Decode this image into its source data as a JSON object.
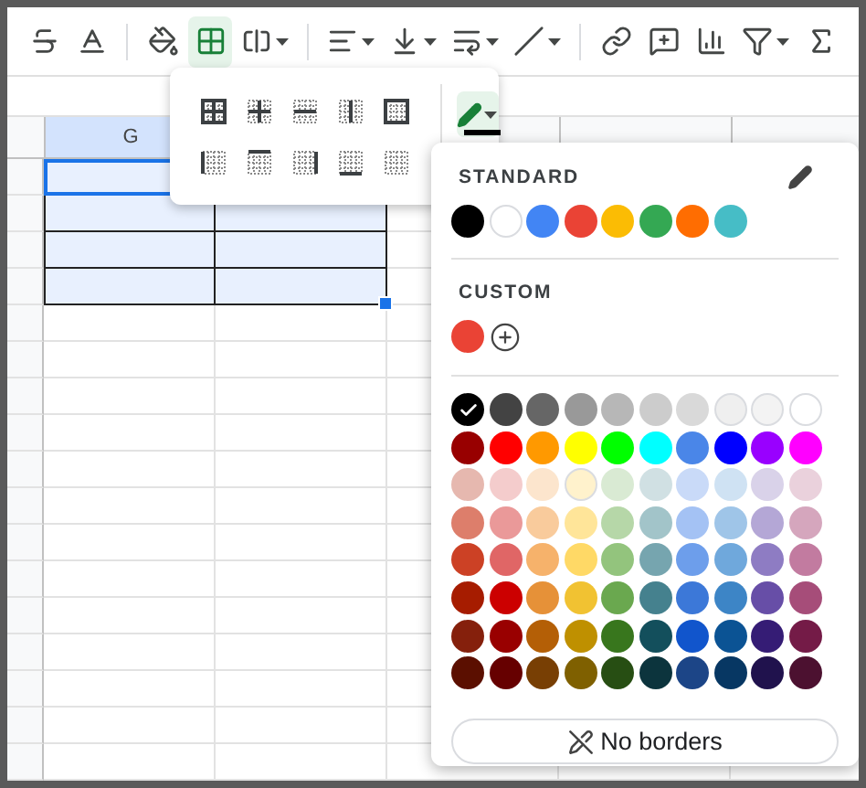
{
  "toolbar": {
    "borders_button": {
      "selected": true
    }
  },
  "column_headers": [
    {
      "label": "G",
      "selected": true
    }
  ],
  "selected_cells": [
    {
      "cells": [
        {
          "selected": true,
          "active": true
        }
      ]
    },
    {
      "cells": [
        {
          "selected": true,
          "active": false
        },
        {
          "selected": true,
          "active": false
        }
      ]
    },
    {
      "cells": [
        {
          "selected": true,
          "active": false
        },
        {
          "selected": true,
          "active": false
        }
      ]
    },
    {
      "cells": [
        {
          "selected": true,
          "active": false
        },
        {
          "selected": true,
          "active": false
        }
      ]
    }
  ],
  "borders_menu": {
    "pen": {
      "color": "#000000"
    }
  },
  "color_panel": {
    "standard_label": "STANDARD",
    "standard": [
      {
        "color": "#000000"
      },
      {
        "color": "#ffffff"
      },
      {
        "color": "#4285f4"
      },
      {
        "color": "#ea4335"
      },
      {
        "color": "#fbbc04"
      },
      {
        "color": "#34a853"
      },
      {
        "color": "#ff6d01"
      },
      {
        "color": "#46bdc6"
      }
    ],
    "custom_label": "CUSTOM",
    "custom": [
      {
        "color": "#ea4335"
      }
    ],
    "palette": [
      [
        {
          "color": "#000000",
          "selected": true
        },
        {
          "color": "#434343",
          "selected": false
        },
        {
          "color": "#666666",
          "selected": false
        },
        {
          "color": "#999999",
          "selected": false
        },
        {
          "color": "#b7b7b7",
          "selected": false
        },
        {
          "color": "#cccccc",
          "selected": false
        },
        {
          "color": "#d9d9d9",
          "selected": false
        },
        {
          "color": "#efefef",
          "selected": false
        },
        {
          "color": "#f3f3f3",
          "selected": false
        },
        {
          "color": "#ffffff",
          "selected": false
        }
      ],
      [
        {
          "color": "#980000",
          "selected": false
        },
        {
          "color": "#ff0000",
          "selected": false
        },
        {
          "color": "#ff9900",
          "selected": false
        },
        {
          "color": "#ffff00",
          "selected": false
        },
        {
          "color": "#00ff00",
          "selected": false
        },
        {
          "color": "#00ffff",
          "selected": false
        },
        {
          "color": "#4a86e8",
          "selected": false
        },
        {
          "color": "#0000ff",
          "selected": false
        },
        {
          "color": "#9900ff",
          "selected": false
        },
        {
          "color": "#ff00ff",
          "selected": false
        }
      ],
      [
        {
          "color": "#e6b8af",
          "selected": false
        },
        {
          "color": "#f4cccc",
          "selected": false
        },
        {
          "color": "#fce5cd",
          "selected": false
        },
        {
          "color": "#fff2cc",
          "selected": false
        },
        {
          "color": "#d9ead3",
          "selected": false
        },
        {
          "color": "#d0e0e3",
          "selected": false
        },
        {
          "color": "#c9daf8",
          "selected": false
        },
        {
          "color": "#cfe2f3",
          "selected": false
        },
        {
          "color": "#d9d2e9",
          "selected": false
        },
        {
          "color": "#ead1dc",
          "selected": false
        }
      ],
      [
        {
          "color": "#dd7e6b",
          "selected": false
        },
        {
          "color": "#ea9999",
          "selected": false
        },
        {
          "color": "#f9cb9c",
          "selected": false
        },
        {
          "color": "#ffe599",
          "selected": false
        },
        {
          "color": "#b6d7a8",
          "selected": false
        },
        {
          "color": "#a2c4c9",
          "selected": false
        },
        {
          "color": "#a4c2f4",
          "selected": false
        },
        {
          "color": "#9fc5e8",
          "selected": false
        },
        {
          "color": "#b4a7d6",
          "selected": false
        },
        {
          "color": "#d5a6bd",
          "selected": false
        }
      ],
      [
        {
          "color": "#cc4125",
          "selected": false
        },
        {
          "color": "#e06666",
          "selected": false
        },
        {
          "color": "#f6b26b",
          "selected": false
        },
        {
          "color": "#ffd966",
          "selected": false
        },
        {
          "color": "#93c47d",
          "selected": false
        },
        {
          "color": "#76a5af",
          "selected": false
        },
        {
          "color": "#6d9eeb",
          "selected": false
        },
        {
          "color": "#6fa8dc",
          "selected": false
        },
        {
          "color": "#8e7cc3",
          "selected": false
        },
        {
          "color": "#c27ba0",
          "selected": false
        }
      ],
      [
        {
          "color": "#a61c00",
          "selected": false
        },
        {
          "color": "#cc0000",
          "selected": false
        },
        {
          "color": "#e69138",
          "selected": false
        },
        {
          "color": "#f1c232",
          "selected": false
        },
        {
          "color": "#6aa84f",
          "selected": false
        },
        {
          "color": "#45818e",
          "selected": false
        },
        {
          "color": "#3c78d8",
          "selected": false
        },
        {
          "color": "#3d85c6",
          "selected": false
        },
        {
          "color": "#674ea7",
          "selected": false
        },
        {
          "color": "#a64d79",
          "selected": false
        }
      ],
      [
        {
          "color": "#85200c",
          "selected": false
        },
        {
          "color": "#990000",
          "selected": false
        },
        {
          "color": "#b45f06",
          "selected": false
        },
        {
          "color": "#bf9000",
          "selected": false
        },
        {
          "color": "#38761d",
          "selected": false
        },
        {
          "color": "#134f5c",
          "selected": false
        },
        {
          "color": "#1155cc",
          "selected": false
        },
        {
          "color": "#0b5394",
          "selected": false
        },
        {
          "color": "#351c75",
          "selected": false
        },
        {
          "color": "#741b47",
          "selected": false
        }
      ],
      [
        {
          "color": "#5b0f00",
          "selected": false
        },
        {
          "color": "#660000",
          "selected": false
        },
        {
          "color": "#783f04",
          "selected": false
        },
        {
          "color": "#7f6000",
          "selected": false
        },
        {
          "color": "#274e13",
          "selected": false
        },
        {
          "color": "#0c343d",
          "selected": false
        },
        {
          "color": "#1c4587",
          "selected": false
        },
        {
          "color": "#073763",
          "selected": false
        },
        {
          "color": "#20124d",
          "selected": false
        },
        {
          "color": "#4c1130",
          "selected": false
        }
      ]
    ],
    "no_borders_button": "No borders"
  }
}
